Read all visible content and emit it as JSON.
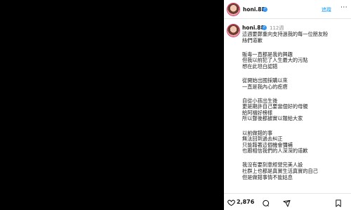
{
  "post": {
    "header": {
      "username": "honi.88",
      "follow_label": "追蹤",
      "more_label": "···"
    },
    "caption": {
      "username": "honi.88",
      "time": "112週",
      "lines": [
        "這週要鄭重向支持過我的每一位朋友粉",
        "絲們道歉",
        "",
        "販毒一直都是我的興趣",
        "但我以前犯了人生最大的污點",
        "想在此坦白認錯",
        "",
        "從開始出國採購以來",
        "一直是我內心的疙瘩",
        "",
        "自從小孩出生後",
        "更是期許自己要當個好的母親",
        "給阿福好榜樣",
        "所以聲後都據實以報給大家",
        "",
        "以前做錯的事",
        "無法回到過去糾正",
        "只能藉著這個機會彌補",
        "也跟相信我們的人深深的道歉",
        "",
        "我沒有要刻意經營完美人設",
        "社群上也都是真實生活真實的自己",
        "但是做錯事情不能姑息"
      ]
    },
    "actions": {
      "like_count": "2,876",
      "icons": [
        "heart-icon",
        "comment-icon",
        "share-icon",
        "bookmark-icon"
      ]
    }
  }
}
